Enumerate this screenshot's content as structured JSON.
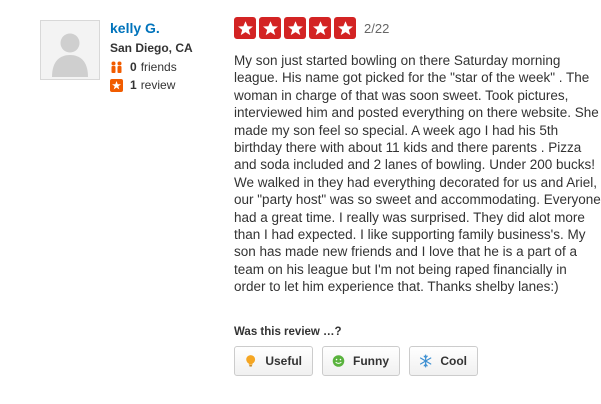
{
  "user": {
    "name": "kelly G.",
    "location": "San Diego, CA",
    "friends": {
      "count": "0",
      "label": "friends",
      "icon": "friends-icon"
    },
    "reviews": {
      "count": "1",
      "label": "review",
      "icon": "review-star-icon"
    }
  },
  "review": {
    "rating": 5,
    "rating_max": 5,
    "date": "2/22",
    "text": "My son just started bowling on there Saturday morning league.  His name got picked for the \"star of the week\" . The woman in charge of that was soon sweet.  Took pictures,  interviewed him and posted everything on there website. She made my son feel so special. A week ago I had his 5th birthday there with about 11 kids and there parents . Pizza and soda included and 2 lanes of bowling. Under 200 bucks! We walked in they had everything decorated for us and Ariel, our \"party host\" was so sweet and accommodating.  Everyone had a great time. I really was surprised. They did alot more than I had expected.  I like supporting family business's. My son has made new friends and I love that he is a part of a team on his league but I'm not being raped financially in order to let him experience that. Thanks shelby lanes:)"
  },
  "feedback": {
    "prompt": "Was this review …?",
    "useful_label": "Useful",
    "funny_label": "Funny",
    "cool_label": "Cool"
  },
  "colors": {
    "star_fill": "#d32323",
    "user_link": "#0073bb",
    "friends_icon": "#f15c00",
    "review_icon": "#f15c00",
    "useful_icon": "#f5a623",
    "funny_icon": "#5ab33e",
    "cool_icon": "#3d8fd1"
  }
}
